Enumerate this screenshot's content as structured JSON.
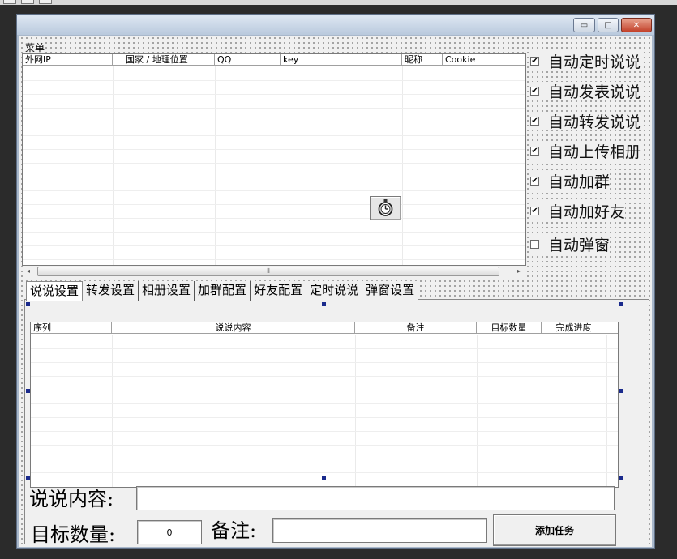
{
  "window": {
    "min_label": "▭",
    "max_label": "□",
    "close_label": "✕"
  },
  "menu": {
    "label": "菜单"
  },
  "proxy_list": {
    "columns": [
      "外网IP",
      "国家 / 地理位置",
      "QQ",
      "key",
      "昵称",
      "Cookie"
    ],
    "rows": []
  },
  "scrollbar": {
    "left_arrow": "◂",
    "right_arrow": "▸",
    "grip": "⦀"
  },
  "options": [
    {
      "label": "自动定时说说",
      "checked": true
    },
    {
      "label": "自动发表说说",
      "checked": true
    },
    {
      "label": "自动转发说说",
      "checked": true
    },
    {
      "label": "自动上传相册",
      "checked": true
    },
    {
      "label": "自动加群",
      "checked": true
    },
    {
      "label": "自动加好友",
      "checked": true
    },
    {
      "label": "自动弹窗",
      "checked": false
    }
  ],
  "tabs": [
    "说说设置",
    "转发设置",
    "相册设置",
    "加群配置",
    "好友配置",
    "定时说说",
    "弹窗设置"
  ],
  "task_list": {
    "columns": [
      "序列",
      "说说内容",
      "备注",
      "目标数量",
      "完成进度"
    ],
    "rows": []
  },
  "form": {
    "content_label": "说说内容:",
    "content_value": "",
    "count_label": "目标数量:",
    "count_value": "0",
    "note_label": "备注:",
    "note_value": "",
    "add_button": "添加任务"
  }
}
